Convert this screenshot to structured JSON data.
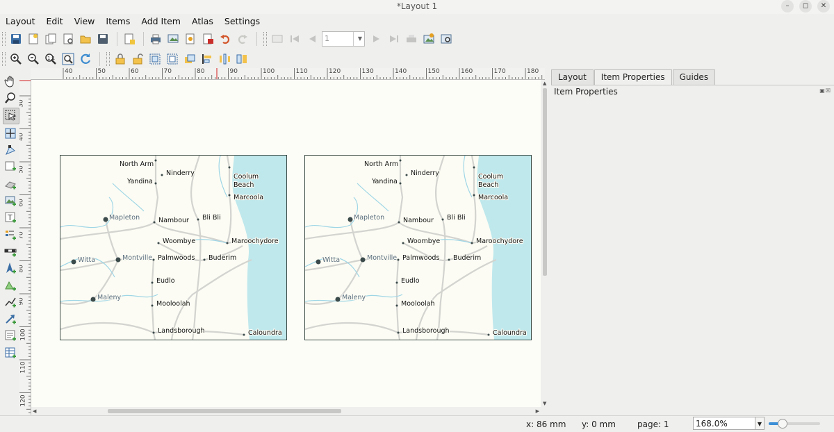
{
  "window": {
    "title": "*Layout 1"
  },
  "menu": [
    "Layout",
    "Edit",
    "View",
    "Items",
    "Add Item",
    "Atlas",
    "Settings"
  ],
  "toolbar": {
    "page_field": "1"
  },
  "ruler": {
    "h_labels": [
      "40",
      "50",
      "60",
      "70",
      "80",
      "90",
      "100",
      "110",
      "120",
      "130",
      "140",
      "150",
      "160",
      "170",
      "180"
    ],
    "v_labels": [
      "30",
      "40",
      "50",
      "60",
      "70",
      "80",
      "90",
      "100",
      "110",
      "120"
    ]
  },
  "map": {
    "places": [
      {
        "name": "North Arm",
        "style": "town"
      },
      {
        "name": "Ninderry",
        "style": "town"
      },
      {
        "name": "Yandina",
        "style": "town"
      },
      {
        "name": "Coolum",
        "style": "town"
      },
      {
        "name": "Beach",
        "style": "town"
      },
      {
        "name": "Marcoola",
        "style": "town"
      },
      {
        "name": "Mapleton",
        "style": "village"
      },
      {
        "name": "Nambour",
        "style": "town"
      },
      {
        "name": "Bli Bli",
        "style": "town"
      },
      {
        "name": "Woombye",
        "style": "town"
      },
      {
        "name": "Maroochydore",
        "style": "town"
      },
      {
        "name": "Witta",
        "style": "village"
      },
      {
        "name": "Montville",
        "style": "village"
      },
      {
        "name": "Palmwoods",
        "style": "town"
      },
      {
        "name": "Buderim",
        "style": "town"
      },
      {
        "name": "Eudlo",
        "style": "town"
      },
      {
        "name": "Maleny",
        "style": "village"
      },
      {
        "name": "Mooloolah",
        "style": "town"
      },
      {
        "name": "Landsborough",
        "style": "town"
      },
      {
        "name": "Caloundra",
        "style": "town"
      }
    ]
  },
  "panel": {
    "tabs": [
      "Layout",
      "Item Properties",
      "Guides"
    ],
    "title": "Item Properties"
  },
  "status": {
    "x": "x: 86 mm",
    "y": "y: 0 mm",
    "page": "page: 1",
    "zoom": "168.0%",
    "zoom_slider_fraction": 0.25
  },
  "colors": {
    "water": "#bfe8ec",
    "road": "#d3d3d0",
    "river": "#9fd6e6",
    "frame": "#3a4a44"
  }
}
